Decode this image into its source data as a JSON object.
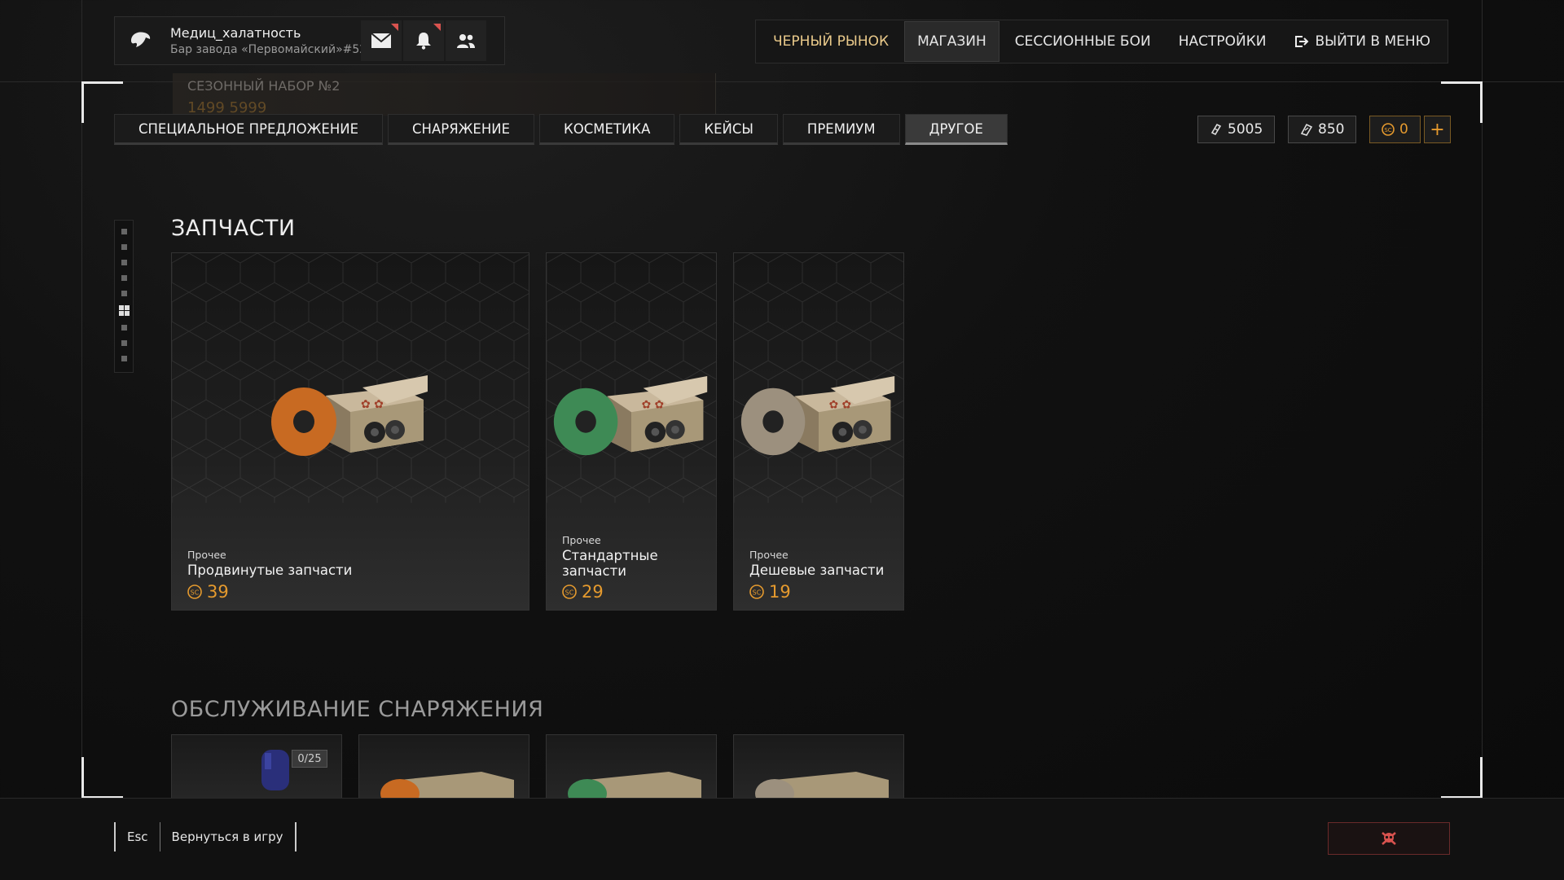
{
  "profile": {
    "name": "Медиц_халатность",
    "subtitle": "Бар завода «Первомайский»#52",
    "emblem_icon": "eagle-emblem-icon",
    "buttons": [
      "mail-icon",
      "bell-icon",
      "friends-icon"
    ]
  },
  "topnav": {
    "black_market": "ЧЕРНЫЙ РЫНОК",
    "shop": "МАГАЗИН",
    "sessions": "СЕССИОННЫЕ БОИ",
    "settings": "НАСТРОЙКИ",
    "exit": "ВЫЙТИ В МЕНЮ"
  },
  "season_banner": {
    "title": "СЕЗОННЫЙ НАБОР №2",
    "price": "1499 5999"
  },
  "tabs": [
    "СПЕЦИАЛЬНОЕ ПРЕДЛОЖЕНИЕ",
    "СНАРЯЖЕНИЕ",
    "КОСМЕТИКА",
    "КЕЙСЫ",
    "ПРЕМИУМ",
    "ДРУГОЕ"
  ],
  "active_tab": "ДРУГОЕ",
  "currencies": {
    "silver": "5005",
    "tickets": "850",
    "gold": "0",
    "add": "+"
  },
  "sections": {
    "spare_parts": "ЗАПЧАСТИ",
    "maintenance": "ОБСЛУЖИВАНИЕ СНАРЯЖЕНИЯ"
  },
  "products": [
    {
      "category": "Прочее",
      "title": "Продвинутые запчасти",
      "price": "39",
      "disc_color": "#c86a22"
    },
    {
      "category": "Прочее",
      "title": "Стандартные запчасти",
      "price": "29",
      "disc_color": "#3e8a55"
    },
    {
      "category": "Прочее",
      "title": "Дешевые запчасти",
      "price": "19",
      "disc_color": "#9c907e"
    }
  ],
  "maintenance_badge": "0/25",
  "bottom": {
    "esc_key": "Esc",
    "esc_label": "Вернуться в игру"
  },
  "colors": {
    "accent_gold": "#e59a2e",
    "market_text": "#e9c98a",
    "danger": "#d9534f"
  }
}
